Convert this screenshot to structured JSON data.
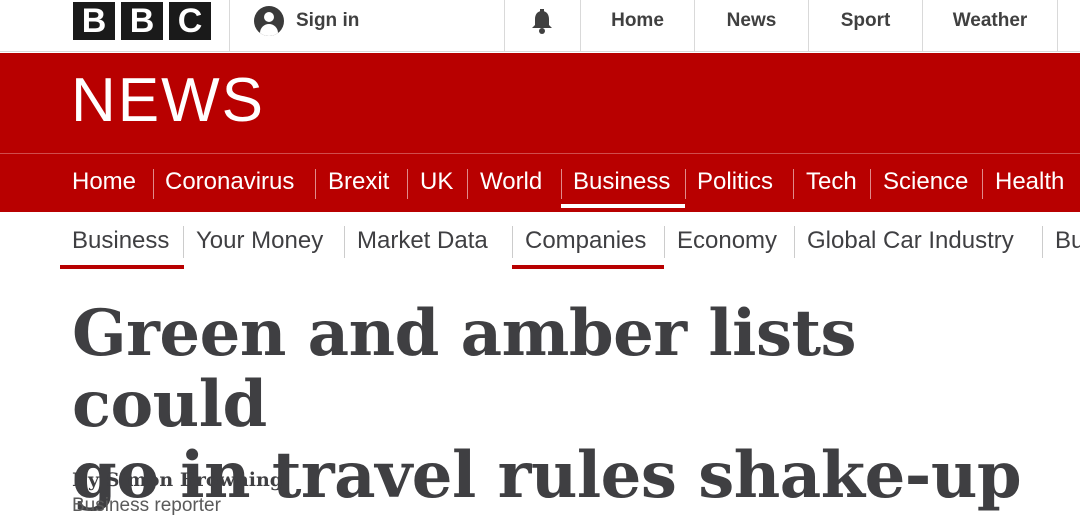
{
  "topbar": {
    "logo_letters": [
      "B",
      "B",
      "C"
    ],
    "sign_in_label": "Sign in",
    "nav": [
      "Home",
      "News",
      "Sport",
      "Weather"
    ],
    "icons": {
      "account": "user-icon",
      "notifications": "bell-icon"
    }
  },
  "banner": {
    "title": "NEWS",
    "color": "#b80000"
  },
  "main_nav": {
    "items": [
      "Home",
      "Coronavirus",
      "Brexit",
      "UK",
      "World",
      "Business",
      "Politics",
      "Tech",
      "Science",
      "Health"
    ],
    "active": "Business"
  },
  "sub_nav": {
    "items": [
      "Business",
      "Your Money",
      "Market Data",
      "Companies",
      "Economy",
      "Global Car Industry",
      "Bu"
    ],
    "active": [
      "Business",
      "Companies"
    ]
  },
  "article": {
    "headline_line1": "Green and amber lists could",
    "headline_line2": "go in travel rules shake-up",
    "byline": "By Simon Browning",
    "role": "Business reporter"
  }
}
